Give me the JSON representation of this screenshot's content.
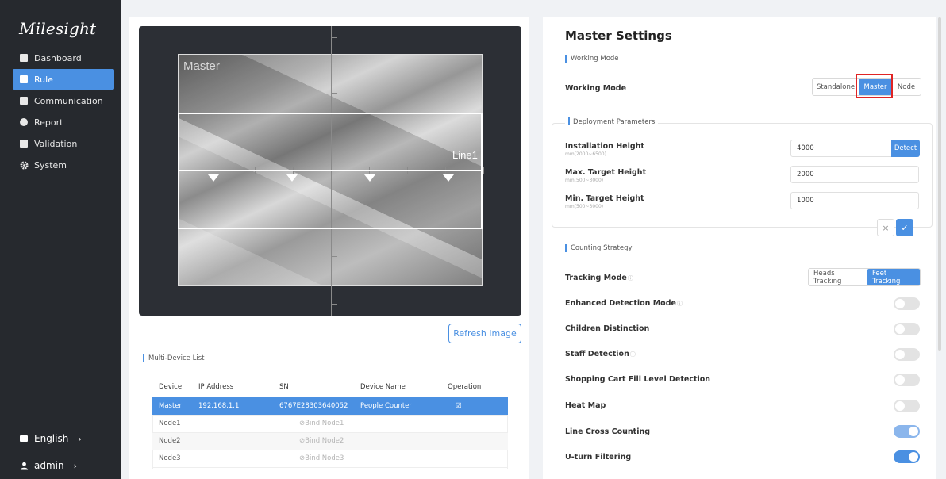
{
  "brand": {
    "name": "Milesight"
  },
  "sidebar": {
    "items": [
      {
        "label": "Dashboard",
        "icon": "dashboard-icon"
      },
      {
        "label": "Rule",
        "icon": "rule-icon",
        "active": true
      },
      {
        "label": "Communication",
        "icon": "communication-icon"
      },
      {
        "label": "Report",
        "icon": "report-icon"
      },
      {
        "label": "Validation",
        "icon": "validation-icon"
      },
      {
        "label": "System",
        "icon": "gear-icon"
      }
    ],
    "language": "English",
    "user": "admin",
    "chevron": "›"
  },
  "camera": {
    "area_label": "Master",
    "line_label": "Line1",
    "refresh_label": "Refresh Image"
  },
  "device_list": {
    "section_label": "Multi-Device List",
    "columns": [
      "Device",
      "IP Address",
      "SN",
      "Device Name",
      "Operation"
    ],
    "rows": [
      {
        "device": "Master",
        "ip": "192.168.1.1",
        "sn": "6767E28303640052",
        "name": "People Counter",
        "operation": "☑"
      },
      {
        "device": "Node1",
        "bind": "Bind Node1"
      },
      {
        "device": "Node2",
        "bind": "Bind Node2"
      },
      {
        "device": "Node3",
        "bind": "Bind Node3"
      }
    ]
  },
  "settings": {
    "title": "Master Settings",
    "working_mode_section": "Working Mode",
    "working_mode_label": "Working Mode",
    "working_mode_options": [
      "Standalone",
      "Master",
      "Node"
    ],
    "working_mode_selected": "Master",
    "deployment_section": "Deployment Parameters",
    "installation_height": {
      "label": "Installation Height",
      "range": "mm(2000~6500)",
      "value": "4000",
      "button": "Detect"
    },
    "max_target_height": {
      "label": "Max. Target Height",
      "range": "mm(500~3000)",
      "value": "2000"
    },
    "min_target_height": {
      "label": "Min. Target Height",
      "range": "mm(500~3000)",
      "value": "1000"
    },
    "cancel_symbol": "×",
    "confirm_symbol": "✓",
    "counting_section": "Counting Strategy",
    "tracking_mode_label": "Tracking Mode",
    "tracking_options": [
      "Heads Tracking",
      "Feet Tracking"
    ],
    "tracking_selected": "Feet Tracking",
    "info_symbol": "ⓘ",
    "toggles": [
      {
        "label": "Enhanced Detection Mode",
        "info": true,
        "on": false
      },
      {
        "label": "Children Distinction",
        "info": false,
        "on": false
      },
      {
        "label": "Staff Detection",
        "info": true,
        "on": false
      },
      {
        "label": "Shopping Cart Fill Level Detection",
        "info": false,
        "on": false
      },
      {
        "label": "Heat Map",
        "info": false,
        "on": false
      },
      {
        "label": "Line Cross Counting",
        "info": false,
        "on": true
      },
      {
        "label": "U-turn Filtering",
        "info": false,
        "on": true
      }
    ],
    "colors": {
      "accent": "#4a90e2",
      "highlight": "#e02424",
      "sidebar": "#26292e"
    }
  }
}
